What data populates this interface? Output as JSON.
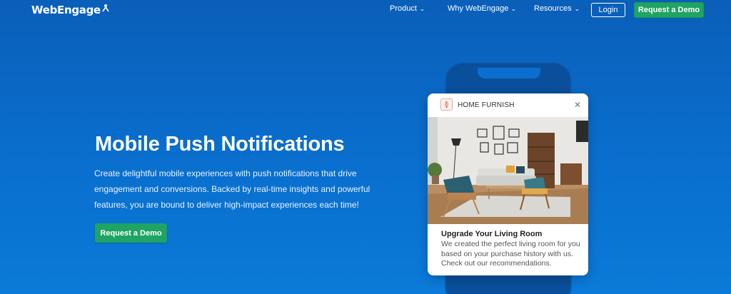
{
  "nav": {
    "logo_text": "WebEngage",
    "items": [
      {
        "label": "Product"
      },
      {
        "label": "Why WebEngage"
      },
      {
        "label": "Resources"
      }
    ],
    "login_label": "Login",
    "demo_label": "Request a Demo"
  },
  "hero": {
    "title": "Mobile Push Notifications",
    "description": "Create delightful mobile experiences with push notifications that drive engagement and conversions. Backed by real-time insights and powerful features, you are bound to deliver high-impact experiences each time!",
    "demo_label": "Request a Demo"
  },
  "notification": {
    "brand": "HOME FURNISH",
    "title": "Upgrade Your Living Room",
    "body": "We created the perfect living room for you based on your purchase history with us. Check out our recommendations."
  },
  "colors": {
    "background": "#0a6fce",
    "accent_green": "#1fa463",
    "card_bg": "#ffffff"
  }
}
